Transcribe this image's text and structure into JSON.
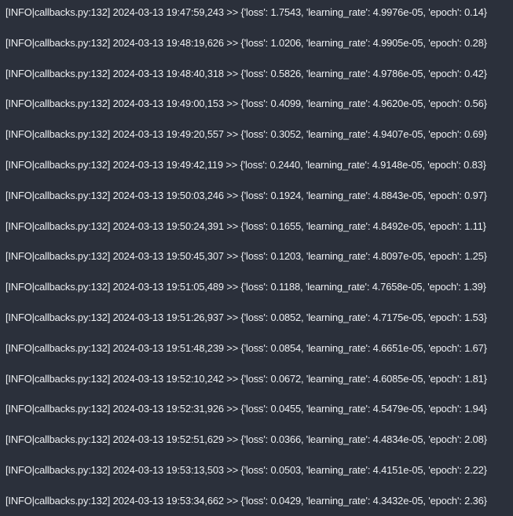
{
  "log": {
    "lines": [
      "[INFO|callbacks.py:132] 2024-03-13 19:47:59,243 >> {'loss': 1.7543, 'learning_rate': 4.9976e-05, 'epoch': 0.14}",
      "[INFO|callbacks.py:132] 2024-03-13 19:48:19,626 >> {'loss': 1.0206, 'learning_rate': 4.9905e-05, 'epoch': 0.28}",
      "[INFO|callbacks.py:132] 2024-03-13 19:48:40,318 >> {'loss': 0.5826, 'learning_rate': 4.9786e-05, 'epoch': 0.42}",
      "[INFO|callbacks.py:132] 2024-03-13 19:49:00,153 >> {'loss': 0.4099, 'learning_rate': 4.9620e-05, 'epoch': 0.56}",
      "[INFO|callbacks.py:132] 2024-03-13 19:49:20,557 >> {'loss': 0.3052, 'learning_rate': 4.9407e-05, 'epoch': 0.69}",
      "[INFO|callbacks.py:132] 2024-03-13 19:49:42,119 >> {'loss': 0.2440, 'learning_rate': 4.9148e-05, 'epoch': 0.83}",
      "[INFO|callbacks.py:132] 2024-03-13 19:50:03,246 >> {'loss': 0.1924, 'learning_rate': 4.8843e-05, 'epoch': 0.97}",
      "[INFO|callbacks.py:132] 2024-03-13 19:50:24,391 >> {'loss': 0.1655, 'learning_rate': 4.8492e-05, 'epoch': 1.11}",
      "[INFO|callbacks.py:132] 2024-03-13 19:50:45,307 >> {'loss': 0.1203, 'learning_rate': 4.8097e-05, 'epoch': 1.25}",
      "[INFO|callbacks.py:132] 2024-03-13 19:51:05,489 >> {'loss': 0.1188, 'learning_rate': 4.7658e-05, 'epoch': 1.39}",
      "[INFO|callbacks.py:132] 2024-03-13 19:51:26,937 >> {'loss': 0.0852, 'learning_rate': 4.7175e-05, 'epoch': 1.53}",
      "[INFO|callbacks.py:132] 2024-03-13 19:51:48,239 >> {'loss': 0.0854, 'learning_rate': 4.6651e-05, 'epoch': 1.67}",
      "[INFO|callbacks.py:132] 2024-03-13 19:52:10,242 >> {'loss': 0.0672, 'learning_rate': 4.6085e-05, 'epoch': 1.81}",
      "[INFO|callbacks.py:132] 2024-03-13 19:52:31,926 >> {'loss': 0.0455, 'learning_rate': 4.5479e-05, 'epoch': 1.94}",
      "[INFO|callbacks.py:132] 2024-03-13 19:52:51,629 >> {'loss': 0.0366, 'learning_rate': 4.4834e-05, 'epoch': 2.08}",
      "[INFO|callbacks.py:132] 2024-03-13 19:53:13,503 >> {'loss': 0.0503, 'learning_rate': 4.4151e-05, 'epoch': 2.22}",
      "[INFO|callbacks.py:132] 2024-03-13 19:53:34,662 >> {'loss': 0.0429, 'learning_rate': 4.3432e-05, 'epoch': 2.36}"
    ]
  },
  "colors": {
    "background": "#2b303b",
    "text": "#eef0f3"
  }
}
